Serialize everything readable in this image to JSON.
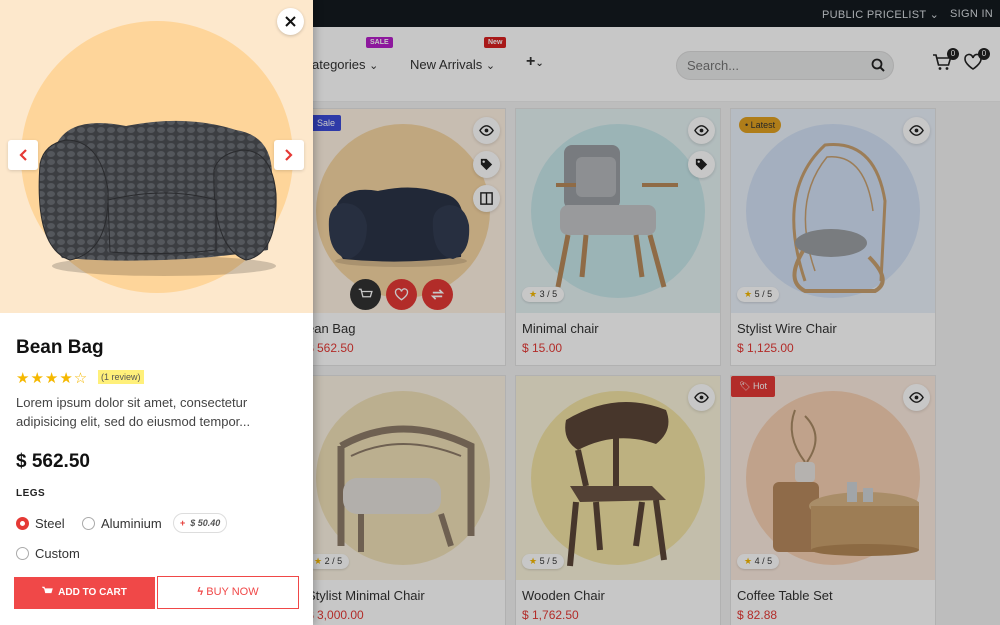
{
  "topbar": {
    "pricelist": "PUBLIC PRICELIST",
    "signin": "SIGN IN"
  },
  "nav": {
    "categories": "ategories",
    "categories_badge": "SALE",
    "new_arrivals": "New Arrivals",
    "new_arrivals_badge": "New",
    "more_symbol": "+"
  },
  "search": {
    "placeholder": "Search..."
  },
  "header_icons": {
    "cart_count": "0",
    "wishlist_count": "0"
  },
  "products": [
    {
      "name": "ean Bag",
      "price": "$ 562.50",
      "tag": "Sale",
      "circle_color": "#f7d6a3",
      "bg": "#fff2e3"
    },
    {
      "name": "Minimal chair",
      "price": "$ 15.00",
      "rating": "3 / 5",
      "circle_color": "#c7e7ea",
      "bg": "#e5f2f3"
    },
    {
      "name": "Stylist Wire Chair",
      "price": "$ 1,125.00",
      "rating": "5 / 5",
      "tag": "Latest",
      "circle_color": "#d2e1f5",
      "bg": "#eaf1fa"
    },
    {
      "name": "Stylist Minimal Chair",
      "price": "$ 3,000.00",
      "rating": "2 / 5",
      "circle_color": "#f0e0b8",
      "bg": "#fbf3e3"
    },
    {
      "name": "Wooden Chair",
      "price": "$ 1,762.50",
      "rating": "5 / 5",
      "circle_color": "#f2e3a5",
      "bg": "#faf4dc"
    },
    {
      "name": "Coffee Table Set",
      "price": "$ 82.88",
      "rating": "4 / 5",
      "tag": "Hot",
      "circle_color": "#f7d0b3",
      "bg": "#fcebdf"
    }
  ],
  "quickview": {
    "title": "Bean Bag",
    "stars": "★★★★☆",
    "reviews": "(1 review)",
    "description": "Lorem ipsum dolor sit amet, consectetur adipisicing elit, sed do eiusmod tempor...",
    "price": "$ 562.50",
    "option_title": "LEGS",
    "options": [
      "Steel",
      "Aluminium",
      "Custom"
    ],
    "extra_sign": "+",
    "extra_price": "$ 50.40",
    "add_to_cart": "ADD TO CART",
    "buy_now": "BUY NOW"
  }
}
